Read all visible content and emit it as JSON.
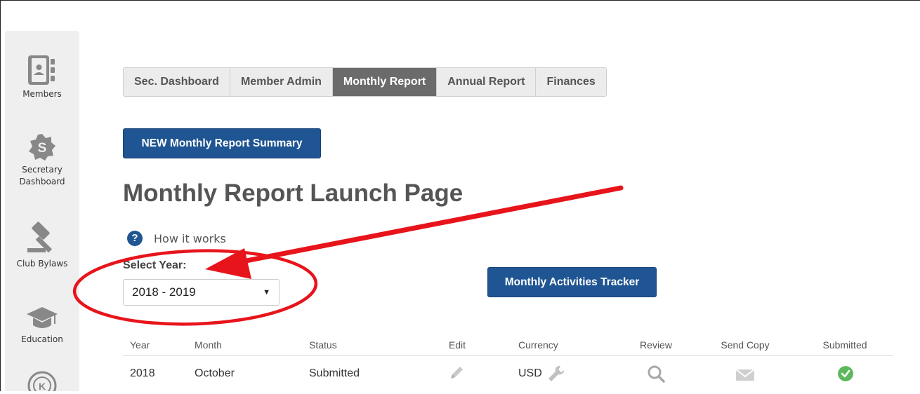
{
  "sidebar": {
    "items": [
      {
        "label": "Members",
        "icon": "members-book-icon"
      },
      {
        "label": "Secretary Dashboard",
        "icon": "dollar-badge-icon"
      },
      {
        "label": "Club Bylaws",
        "icon": "gavel-icon"
      },
      {
        "label": "Education",
        "icon": "graduation-cap-icon"
      },
      {
        "label": "",
        "icon": "kiwanis-seal-icon"
      }
    ]
  },
  "tabs": [
    {
      "label": "Sec. Dashboard",
      "active": false
    },
    {
      "label": "Member Admin",
      "active": false
    },
    {
      "label": "Monthly Report",
      "active": true
    },
    {
      "label": "Annual Report",
      "active": false
    },
    {
      "label": "Finances",
      "active": false
    }
  ],
  "new_summary_button": "NEW Monthly Report Summary",
  "page_title": "Monthly Report Launch Page",
  "how_it_works": "How it works",
  "select_year": {
    "label": "Select Year:",
    "value": "2018 - 2019"
  },
  "tracker_button": "Monthly Activities Tracker",
  "table": {
    "headers": [
      "Year",
      "Month",
      "Status",
      "Edit",
      "Currency",
      "Review",
      "Send Copy",
      "Submitted"
    ],
    "rows": [
      {
        "year": "2018",
        "month": "October",
        "status": "Submitted",
        "currency": "USD",
        "submitted": true
      }
    ]
  },
  "colors": {
    "primary": "#1f5592",
    "active_tab": "#6b6b6b",
    "annotation": "#e8141b",
    "check": "#5cb85c"
  }
}
